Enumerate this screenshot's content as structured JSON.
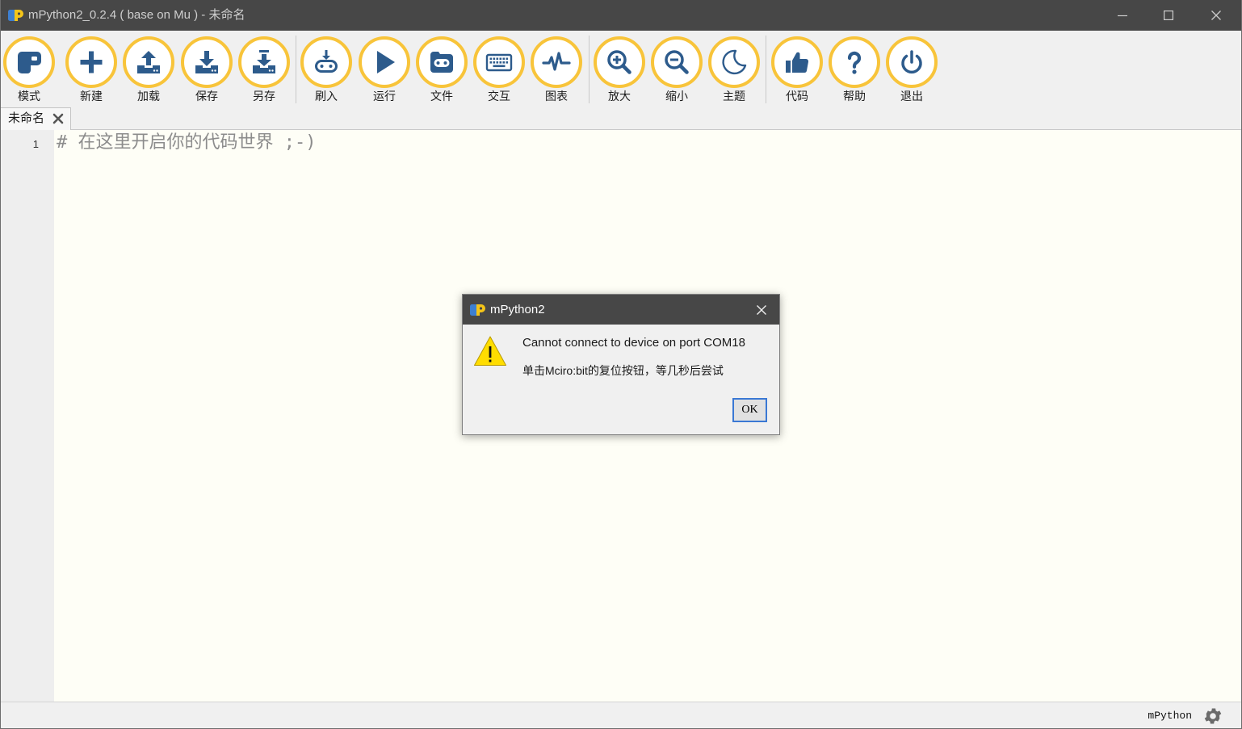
{
  "window": {
    "title": "mPython2_0.2.4 ( base on Mu ) - 未命名",
    "logo_icon": "mpython-logo-icon",
    "controls": {
      "minimize_icon": "minimize-icon",
      "maximize_icon": "maximize-icon",
      "close_icon": "close-icon"
    }
  },
  "toolbar": {
    "buttons": [
      {
        "label": "模式",
        "icon": "mode-icon"
      },
      {
        "label": "新建",
        "icon": "plus-icon"
      },
      {
        "label": "加载",
        "icon": "upload-icon"
      },
      {
        "label": "保存",
        "icon": "download-icon"
      },
      {
        "label": "另存",
        "icon": "save-as-icon"
      },
      {
        "label": "刷入",
        "icon": "flash-icon"
      },
      {
        "label": "运行",
        "icon": "play-icon"
      },
      {
        "label": "文件",
        "icon": "files-icon"
      },
      {
        "label": "交互",
        "icon": "keyboard-icon"
      },
      {
        "label": "图表",
        "icon": "pulse-icon"
      },
      {
        "label": "放大",
        "icon": "zoom-in-icon"
      },
      {
        "label": "缩小",
        "icon": "zoom-out-icon"
      },
      {
        "label": "主题",
        "icon": "moon-icon"
      },
      {
        "label": "代码",
        "icon": "thumbs-up-icon"
      },
      {
        "label": "帮助",
        "icon": "question-icon"
      },
      {
        "label": "退出",
        "icon": "power-icon"
      }
    ]
  },
  "tabs": [
    {
      "label": "未命名",
      "close_icon": "close-icon"
    }
  ],
  "editor": {
    "lines": [
      {
        "number": "1",
        "text": "# 在这里开启你的代码世界 ;-)"
      }
    ]
  },
  "status_bar": {
    "mode": "mPython",
    "settings_icon": "gear-icon"
  },
  "dialog": {
    "title": "mPython2",
    "logo_icon": "mpython-logo-icon",
    "close_icon": "close-icon",
    "icon": "warning-icon",
    "message": "Cannot connect to device on port COM18",
    "detail": "单击Mciro:bit的复位按钮，等几秒后尝试",
    "ok_label": "OK"
  },
  "colors": {
    "titlebar": "#474747",
    "toolbar_bg": "#f0f0f0",
    "button_ring": "#f8c43a",
    "icon": "#2d5b8c",
    "editor_bg": "#fefef6",
    "gutter_bg": "#eeeeee",
    "code_text": "#8c8c8c",
    "focus_border": "#3a78d4",
    "warning": "#ffdd00"
  }
}
